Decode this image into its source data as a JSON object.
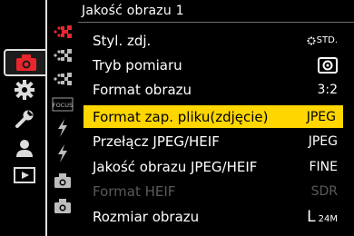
{
  "header": {
    "title": "Jakość obrazu 1"
  },
  "colors": {
    "accent": "#ffd600",
    "active_red": "#e8262c",
    "disabled": "#5a5a5a"
  },
  "sidebar": {
    "categories": [
      {
        "name": "photo-camera-icon",
        "active": true
      },
      {
        "name": "gear-icon",
        "active": false
      },
      {
        "name": "wrench-icon",
        "active": false
      },
      {
        "name": "person-icon",
        "active": false
      },
      {
        "name": "playback-icon",
        "active": false
      }
    ],
    "tabs": [
      {
        "icon": "image-quality-icon",
        "active": true
      },
      {
        "icon": "focus-dots-icon",
        "active": false
      },
      {
        "icon": "metering-dots-icon",
        "active": false
      },
      {
        "icon": "focus-icon",
        "label": "FOCUS",
        "active": false
      },
      {
        "icon": "flash-icon",
        "active": false
      },
      {
        "icon": "flash-icon",
        "active": false
      },
      {
        "icon": "camera-icon",
        "active": false
      },
      {
        "icon": "camera-icon",
        "active": false
      }
    ]
  },
  "menu": {
    "items": [
      {
        "label": "Styl. zdj.",
        "value": "STD.",
        "value_icon": "photo-style-icon",
        "state": "normal"
      },
      {
        "label": "Tryb pomiaru",
        "value": "",
        "value_icon": "metering-mode-icon",
        "state": "normal"
      },
      {
        "label": "Format obrazu",
        "value": "3:2",
        "state": "normal"
      },
      {
        "label": "Format zap. pliku(zdjęcie)",
        "value": "JPEG",
        "state": "selected"
      },
      {
        "label": "Przełącz JPEG/HEIF",
        "value": "JPEG",
        "state": "normal"
      },
      {
        "label": "Jakość obrazu JPEG/HEIF",
        "value": "FINE",
        "state": "normal"
      },
      {
        "label": "Format HEIF",
        "value": "SDR",
        "state": "disabled"
      },
      {
        "label": "Rozmiar obrazu",
        "value": "L",
        "value_suffix": "24M",
        "state": "normal"
      }
    ]
  }
}
